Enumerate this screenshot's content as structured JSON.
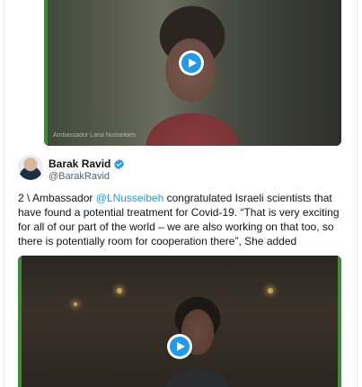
{
  "video1": {
    "caption": "Ambassador Lana Nusseibeh"
  },
  "author": {
    "name": "Barak Ravid",
    "handle": "@BarakRavid"
  },
  "tweet": {
    "prefix": "2 \\ Ambassador ",
    "mention": "@LNusseibeh",
    "body": " congratulated Israeli scientists that have found a potential treatment for Covid-19. “That is very exciting for all of our part of the world – we are also working on that too, so there is potentially room for cooperation there”, She added"
  },
  "colors": {
    "accent": "#1d9bf0",
    "text": "#0f1419",
    "muted": "#536471"
  },
  "icons": {
    "play": "play-icon",
    "verified": "verified-badge-icon"
  }
}
